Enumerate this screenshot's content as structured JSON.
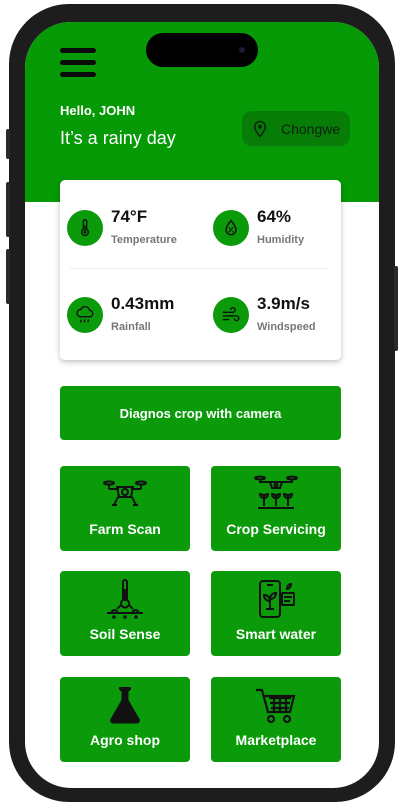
{
  "header": {
    "greeting": "Hello, JOHN",
    "weather_text": "It’s a rainy day",
    "location": "Chongwe"
  },
  "stats": [
    {
      "value": "74°F",
      "label": "Temperature",
      "icon": "thermometer-icon"
    },
    {
      "value": "64%",
      "label": "Humidity",
      "icon": "humidity-drop-icon"
    },
    {
      "value": "0.43mm",
      "label": "Rainfall",
      "icon": "rain-cloud-icon"
    },
    {
      "value": "3.9m/s",
      "label": "Windspeed",
      "icon": "wind-icon"
    }
  ],
  "diagnose_button": "Diagnos crop with camera",
  "tiles": [
    {
      "label": "Farm Scan",
      "icon": "drone-icon"
    },
    {
      "label": "Crop Servicing",
      "icon": "drone-spraying-crops-icon"
    },
    {
      "label": "Soil Sense",
      "icon": "soil-sensor-icon"
    },
    {
      "label": "Smart water",
      "icon": "smartphone-plant-icon"
    },
    {
      "label": "Agro shop",
      "icon": "flask-icon"
    },
    {
      "label": "Marketplace",
      "icon": "shopping-cart-icon"
    }
  ],
  "colors": {
    "brand_green": "#069a06",
    "tile_green": "#0a9a0a",
    "location_pill": "#077c07"
  }
}
